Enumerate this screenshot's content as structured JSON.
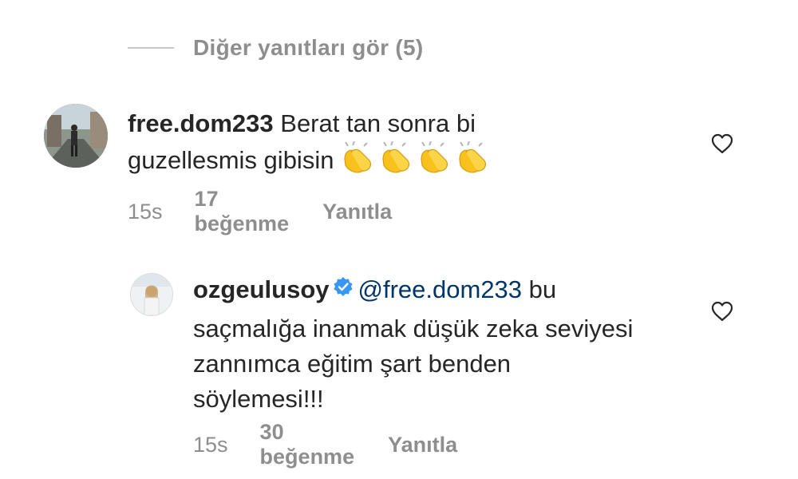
{
  "view_replies": {
    "label": "Diğer yanıtları gör (5)"
  },
  "comments": [
    {
      "username": "free.dom233",
      "text": "Berat tan sonra bi guzellesmis gibisin",
      "emojis": [
        "clapping-hands",
        "clapping-hands",
        "clapping-hands",
        "clapping-hands"
      ],
      "time": "15s",
      "likes": "17 beğenme",
      "reply_label": "Yanıtla"
    },
    {
      "username": "ozgeulusoy",
      "verified": true,
      "mention": "@free.dom233",
      "text": "bu saçmalığa inanmak düşük zeka seviyesi zannımca eğitim şart benden söylemesi!!!",
      "time": "15s",
      "likes": "30 beğenme",
      "reply_label": "Yanıtla"
    }
  ],
  "colors": {
    "text": "#262626",
    "secondary": "#8e8e8e",
    "mention": "#003569",
    "verified": "#3897f0"
  },
  "icons": [
    "heart-icon",
    "verified-badge-icon",
    "clapping-hands-icon"
  ]
}
